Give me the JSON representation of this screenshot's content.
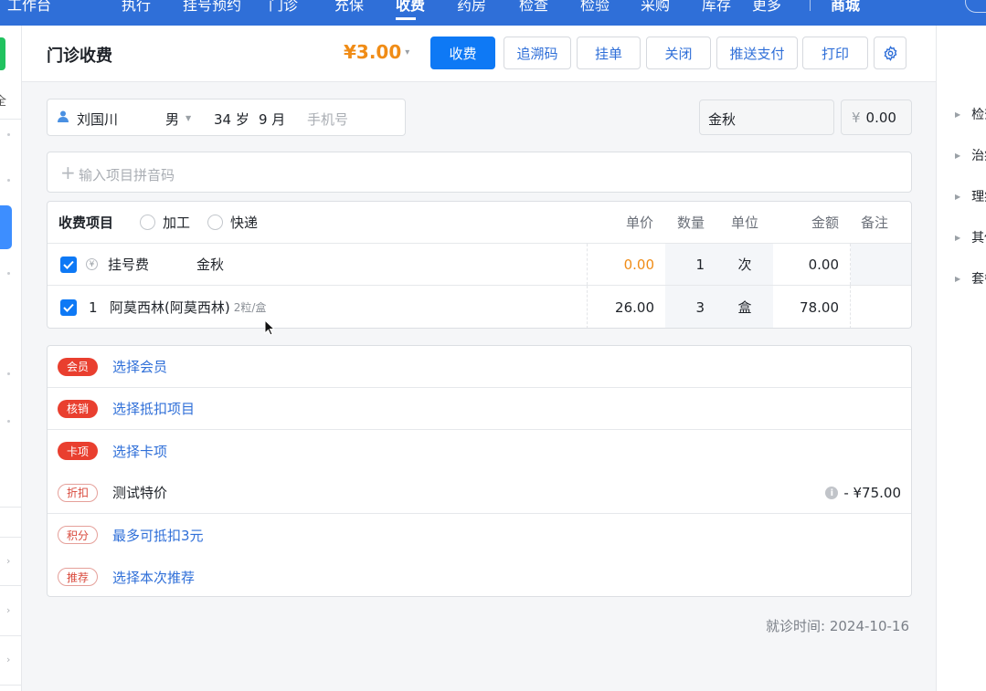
{
  "topnav": {
    "items": [
      "工作台",
      "执行",
      "挂号预约",
      "门诊",
      "充保",
      "收费",
      "药房",
      "检查",
      "检验",
      "采购",
      "库存",
      "更多"
    ],
    "active": "收费",
    "mall": "商城"
  },
  "header": {
    "title": "门诊收费",
    "total": "¥3.00",
    "buttons": {
      "charge": "收费",
      "trace_code": "追溯码",
      "hold": "挂单",
      "close": "关闭",
      "push_pay": "推送支付",
      "print": "打印"
    }
  },
  "patient": {
    "name": "刘国川",
    "gender": "男",
    "age": "34 岁",
    "months": "9 月",
    "phone_placeholder": "手机号"
  },
  "doctor": "金秋",
  "price_box": {
    "currency": "¥",
    "amount": "0.00"
  },
  "search": {
    "placeholder": "输入项目拼音码"
  },
  "table": {
    "title": "收费项目",
    "options": [
      "加工",
      "快递"
    ],
    "columns": {
      "unit_price": "单价",
      "qty": "数量",
      "unit": "单位",
      "amount": "金额",
      "remark": "备注"
    },
    "rows": [
      {
        "name": "挂号费",
        "doctor": "金秋",
        "unit_price": "0.00",
        "qty": "1",
        "unit": "次",
        "amount": "0.00"
      },
      {
        "index": "1",
        "name": "阿莫西林(阿莫西林)",
        "spec": "2粒/盒",
        "unit_price": "26.00",
        "qty": "3",
        "unit": "盒",
        "amount": "78.00"
      }
    ]
  },
  "promotions": [
    {
      "tag": "会员",
      "text": "选择会员"
    },
    {
      "tag": "核销",
      "text": "选择抵扣项目"
    },
    {
      "tag": "卡项",
      "text": "选择卡项"
    },
    {
      "tag": "折扣",
      "text": "测试特价",
      "value": "- ¥75.00"
    },
    {
      "tag": "积分",
      "text": "最多可抵扣3元"
    },
    {
      "tag": "推荐",
      "text": "选择本次推荐"
    }
  ],
  "visit_time": {
    "label": "就诊时间:",
    "value": "2024-10-16"
  },
  "right_panel": [
    "检查",
    "治疗",
    "理疗",
    "其他",
    "套餐"
  ],
  "left_strip": {
    "edge_char": "全"
  },
  "colors": {
    "primary": "#0e79f5",
    "nav": "#2f6fd8",
    "orange": "#f08c16",
    "tag_red": "#e93f2f"
  }
}
